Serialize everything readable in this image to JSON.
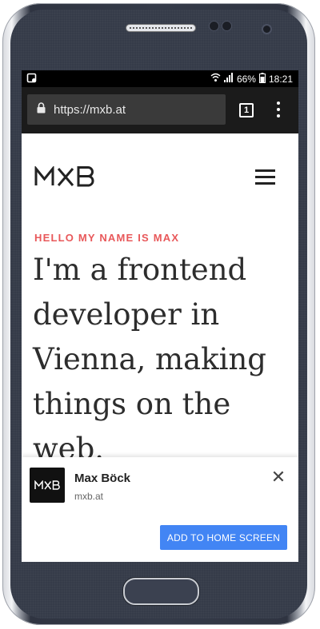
{
  "status_bar": {
    "battery": "66%",
    "time": "18:21"
  },
  "browser": {
    "url": "https://mxb.at",
    "tab_count": "1"
  },
  "site": {
    "logo_text": "MXB",
    "kicker": "HELLO MY NAME IS MAX",
    "headline_lines": [
      "I'm a frontend",
      "developer in",
      "Vienna, making",
      "things on the",
      "web."
    ]
  },
  "install_banner": {
    "icon_text": "MXB",
    "app_name": "Max Böck",
    "app_url": "mxb.at",
    "close_symbol": "✕",
    "add_button_label": "ADD TO HOME SCREEN",
    "button_color": "#4285f4"
  },
  "colors": {
    "kicker": "#e8585a",
    "headline": "#2d2d2d"
  }
}
